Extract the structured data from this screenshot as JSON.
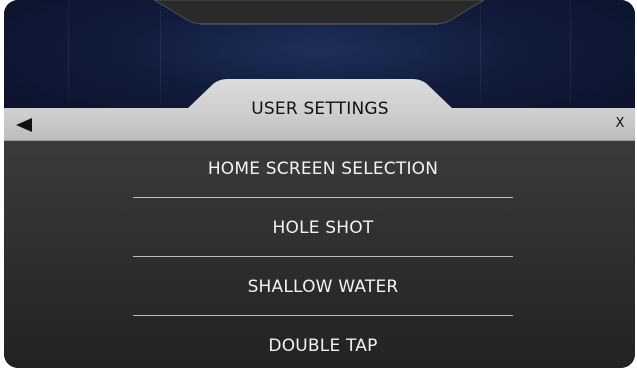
{
  "header": {
    "title": "USER SETTINGS",
    "back_icon": "back-arrow-icon",
    "close_label": "X"
  },
  "menu": {
    "items": [
      {
        "label": "HOME SCREEN SELECTION"
      },
      {
        "label": "HOLE SHOT"
      },
      {
        "label": "SHALLOW WATER"
      },
      {
        "label": "DOUBLE TAP"
      }
    ]
  },
  "colors": {
    "bar": "#c8c8c8",
    "panel": "#2e2e2e",
    "text_on_dark": "#f2f2f2",
    "text_on_light": "#111111",
    "background_top": "#0f1a3a"
  }
}
